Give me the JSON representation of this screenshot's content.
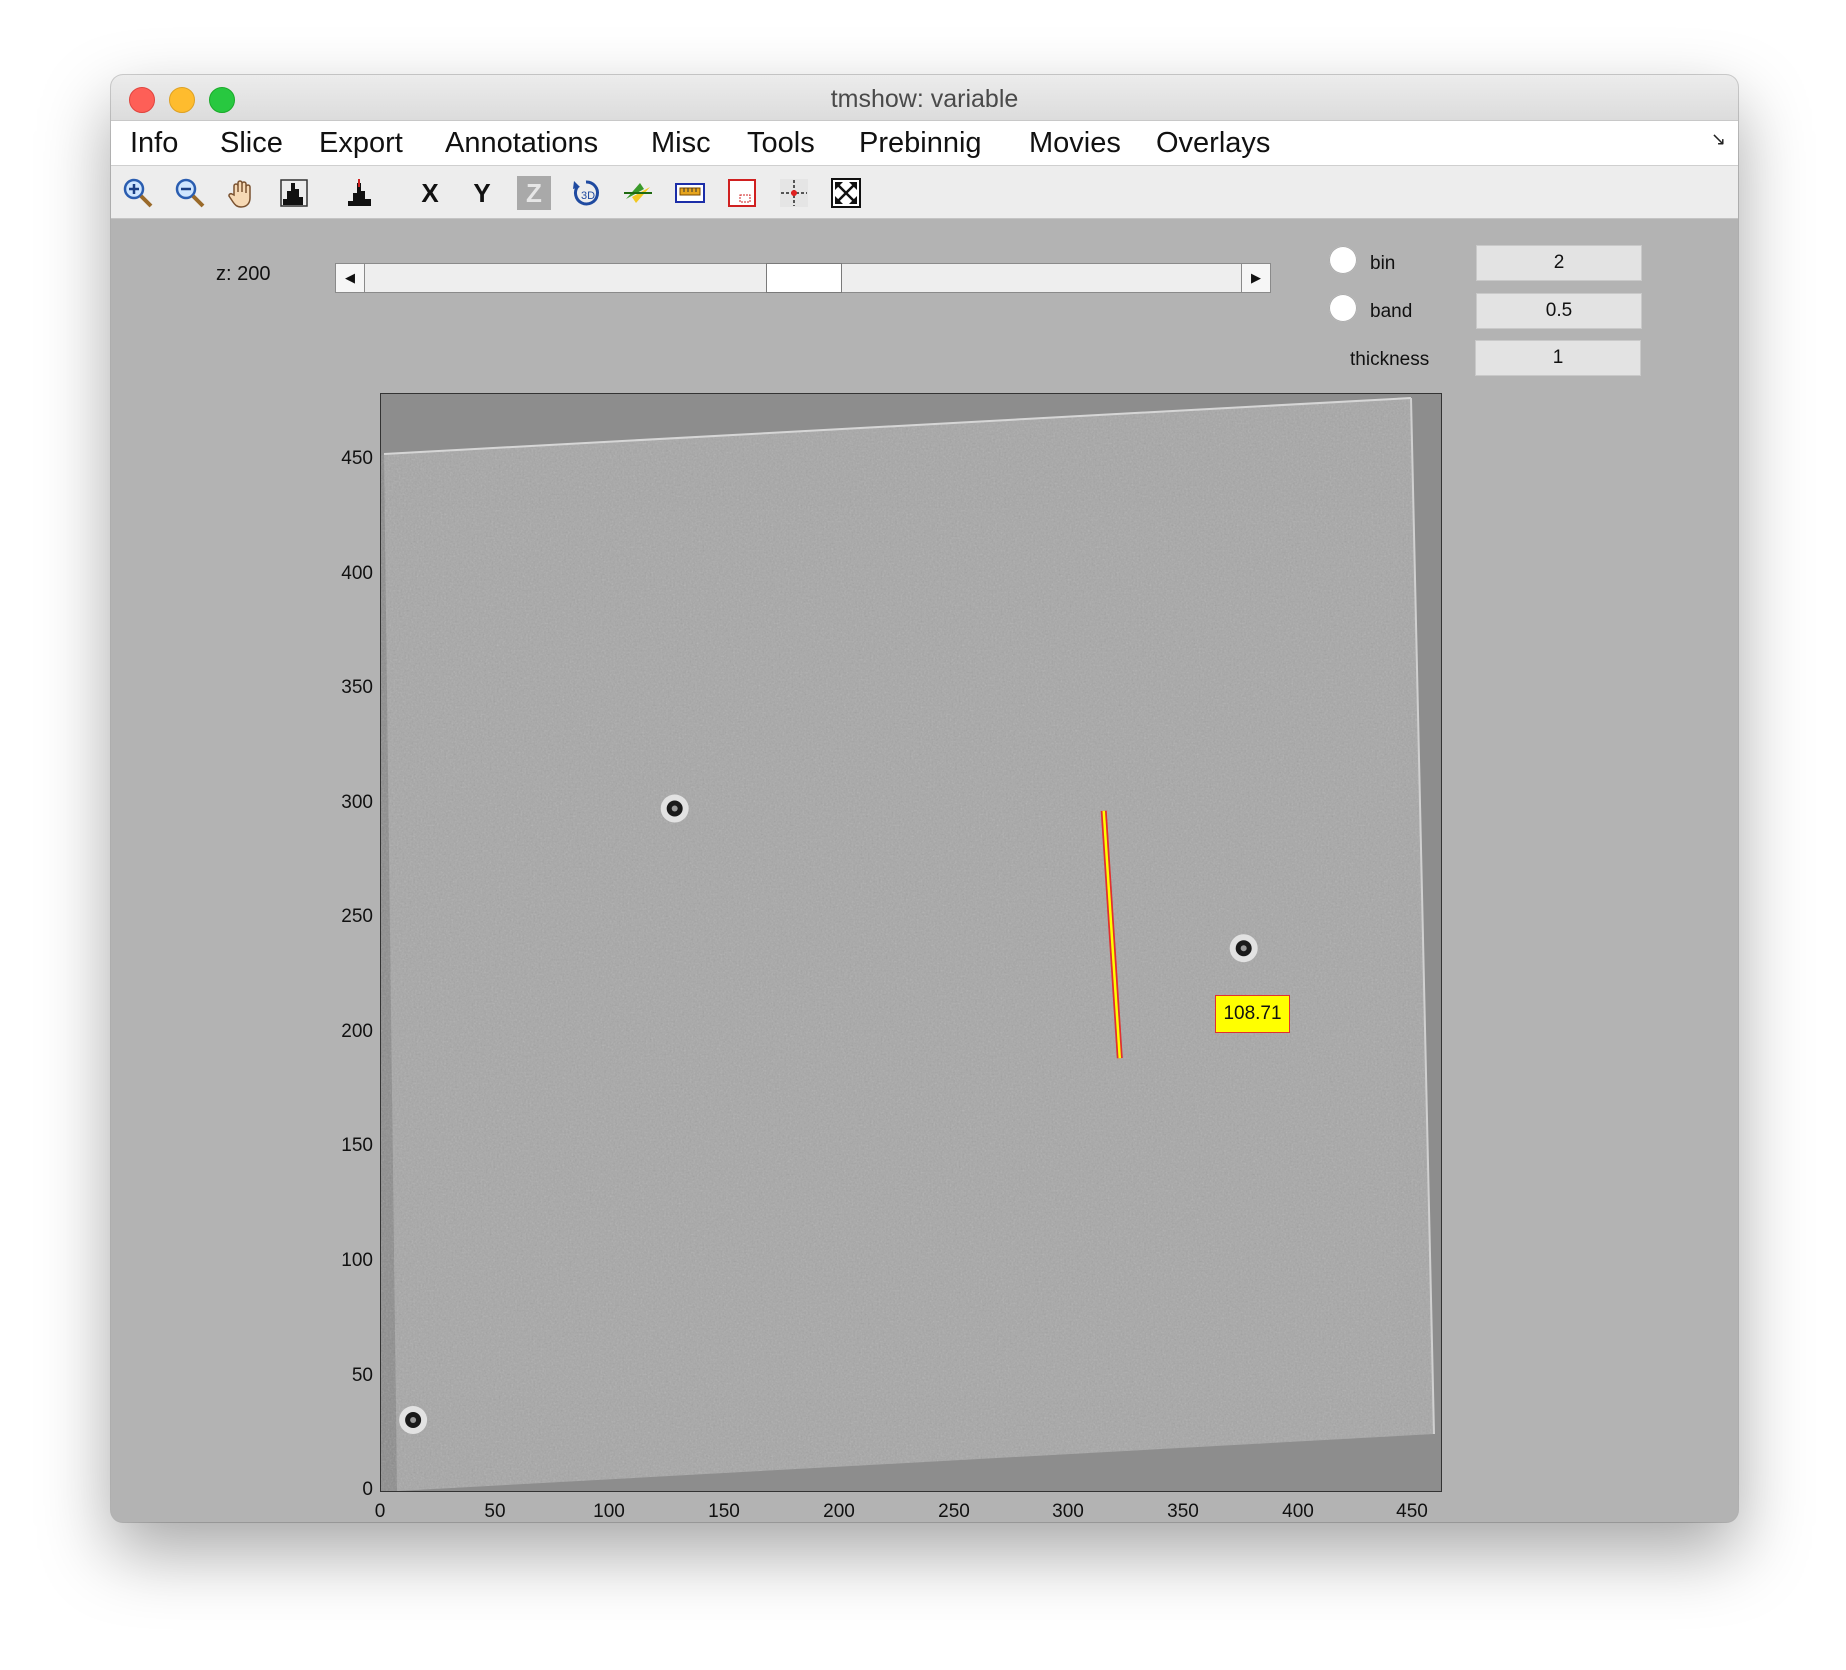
{
  "window": {
    "title": "tmshow: variable"
  },
  "menu": {
    "items": [
      "Info",
      "Slice",
      "Export",
      "Annotations",
      "Misc",
      "Tools",
      "Prebinnig",
      "Movies",
      "Overlays"
    ],
    "arrow": "↘"
  },
  "toolbar": {
    "buttons": [
      {
        "name": "zoom-in-icon"
      },
      {
        "name": "zoom-out-icon"
      },
      {
        "name": "pan-hand-icon"
      },
      {
        "name": "histogram-icon"
      },
      {
        "name": "histogram-alt-icon"
      },
      {
        "name": "slice-x-button",
        "label": "X"
      },
      {
        "name": "slice-y-button",
        "label": "Y"
      },
      {
        "name": "slice-z-button",
        "label": "Z"
      },
      {
        "name": "rotate-icon"
      },
      {
        "name": "flip-icon"
      },
      {
        "name": "ruler-icon"
      },
      {
        "name": "roi-box-icon"
      },
      {
        "name": "crosshair-icon"
      },
      {
        "name": "fullscreen-icon"
      }
    ]
  },
  "slice": {
    "label": "z:",
    "value": "200",
    "slider_fraction": 0.5
  },
  "params": {
    "bin": {
      "label": "bin",
      "value": "2"
    },
    "band": {
      "label": "band",
      "value": "0.5"
    },
    "thickness": {
      "label": "thickness",
      "value": "1"
    }
  },
  "axes": {
    "y_ticks": [
      "450",
      "400",
      "350",
      "300",
      "250",
      "200",
      "150",
      "100",
      "50",
      "0"
    ],
    "x_ticks": [
      "0",
      "50",
      "100",
      "150",
      "200",
      "250",
      "300",
      "350",
      "400",
      "450"
    ],
    "x_range": [
      0,
      462
    ],
    "y_range": [
      0,
      479
    ]
  },
  "measurement": {
    "label": "108.71",
    "start": [
      315,
      297
    ],
    "end": [
      322,
      189
    ],
    "color": "#ffff00",
    "edge_color": "#e03030"
  },
  "fiducials": [
    {
      "x": 128,
      "y": 298
    },
    {
      "x": 376,
      "y": 237
    },
    {
      "x": 14,
      "y": 31
    }
  ]
}
